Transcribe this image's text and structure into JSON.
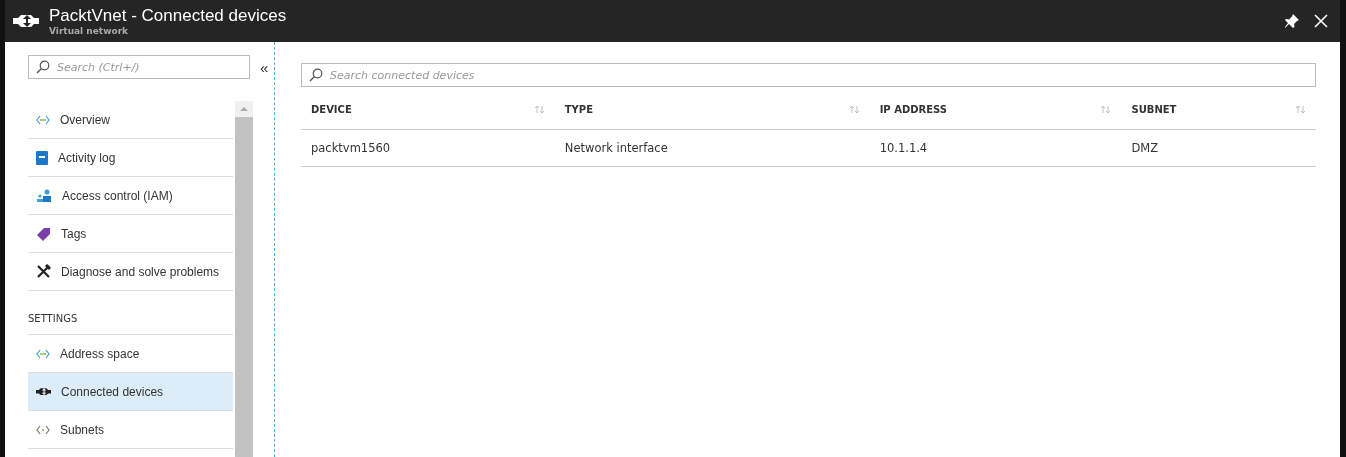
{
  "header": {
    "title": "PacktVnet - Connected devices",
    "subtitle": "Virtual network"
  },
  "sidebar": {
    "search": {
      "placeholder": "Search (Ctrl+/)"
    },
    "collapse": "«",
    "groups": [
      {
        "items": [
          {
            "label": "Overview",
            "kind": "network",
            "selected": false
          },
          {
            "label": "Activity log",
            "kind": "log",
            "selected": false
          },
          {
            "label": "Access control (IAM)",
            "kind": "people",
            "selected": false
          },
          {
            "label": "Tags",
            "kind": "tag",
            "selected": false
          },
          {
            "label": "Diagnose and solve problems",
            "kind": "tools",
            "selected": false
          }
        ]
      },
      {
        "heading": "SETTINGS",
        "items": [
          {
            "label": "Address space",
            "kind": "network",
            "selected": false
          },
          {
            "label": "Connected devices",
            "kind": "devices",
            "selected": true
          },
          {
            "label": "Subnets",
            "kind": "brackets",
            "selected": false
          }
        ]
      }
    ]
  },
  "main": {
    "search": {
      "placeholder": "Search connected devices"
    },
    "table": {
      "columns": [
        "DEVICE",
        "TYPE",
        "IP ADDRESS",
        "SUBNET"
      ],
      "rows": [
        [
          "packtvm1560",
          "Network interface",
          "10.1.1.4",
          "DMZ"
        ]
      ]
    }
  }
}
